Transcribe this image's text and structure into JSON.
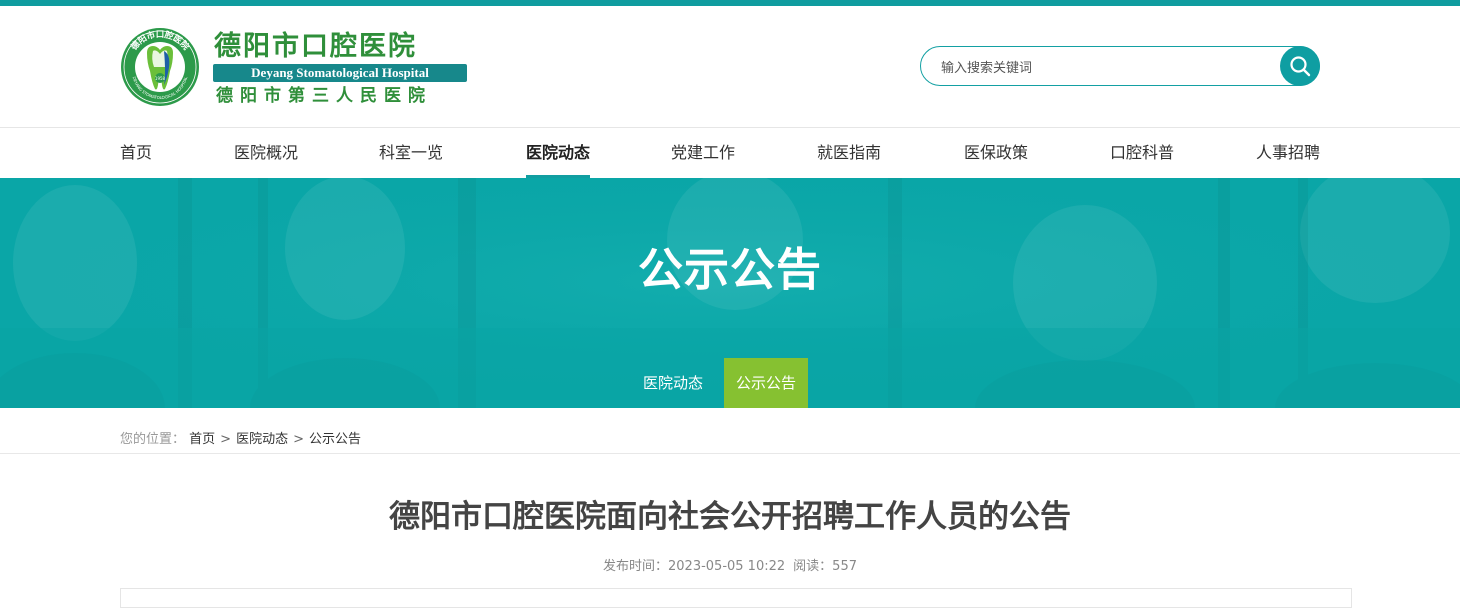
{
  "header": {
    "logo_cn": "德阳市口腔医院",
    "logo_en": "Deyang Stomatological Hospital",
    "logo_sub": "德阳市第三人民医院",
    "logo_ring_text": "德阳市口腔医院",
    "logo_ring_en": "DEYANG STOMATOLOGICAL HOSPITAL",
    "logo_center": "1958"
  },
  "search": {
    "placeholder": "输入搜索关键词",
    "icon": "search-icon"
  },
  "nav": {
    "items": [
      {
        "label": "首页"
      },
      {
        "label": "医院概况"
      },
      {
        "label": "科室一览"
      },
      {
        "label": "医院动态",
        "active": true
      },
      {
        "label": "党建工作"
      },
      {
        "label": "就医指南"
      },
      {
        "label": "医保政策"
      },
      {
        "label": "口腔科普"
      },
      {
        "label": "人事招聘"
      }
    ]
  },
  "banner": {
    "title": "公示公告",
    "subtabs": [
      {
        "label": "医院动态"
      },
      {
        "label": "公示公告",
        "active": true
      }
    ]
  },
  "breadcrumb": {
    "label": "您的位置：",
    "items": [
      "首页",
      "医院动态",
      "公示公告"
    ],
    "separator": ">"
  },
  "article": {
    "title": "德阳市口腔医院面向社会公开招聘工作人员的公告",
    "publish_label": "发布时间：",
    "publish_time": "2023-05-05 10:22",
    "views_label": "阅读：",
    "views": "557"
  },
  "colors": {
    "primary": "#0f9c9f",
    "banner": "#08a4a5",
    "active_tab": "#86c131",
    "logo_green": "#2f8f3a"
  }
}
